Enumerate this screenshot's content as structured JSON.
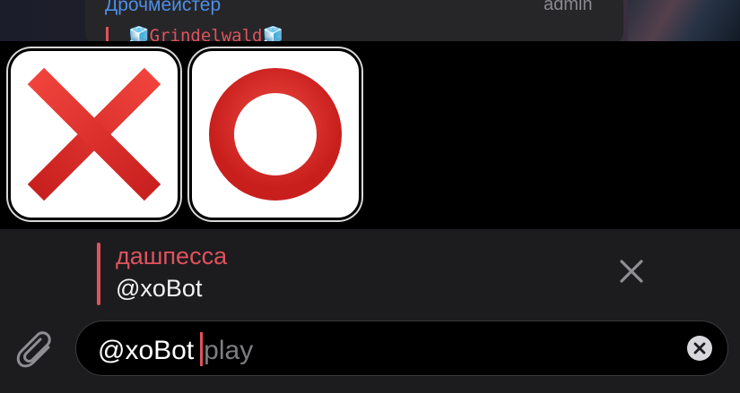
{
  "chat": {
    "sender": "Дрочмейстер",
    "role": "admin",
    "reply_preview": "Grindelwald"
  },
  "stickers": [
    {
      "name": "red-x-sticker",
      "icon": "cross-mark",
      "color": "#e53935"
    },
    {
      "name": "red-o-sticker",
      "icon": "heavy-large-circle",
      "color": "#e53935"
    }
  ],
  "reply": {
    "author": "дашпесса",
    "text": "@xoBot",
    "accent_color": "#e0525d"
  },
  "input": {
    "typed": "@xoBot",
    "hint": "play"
  },
  "icons": {
    "attach": "paperclip-icon",
    "close": "close-icon",
    "clear": "clear-icon"
  }
}
